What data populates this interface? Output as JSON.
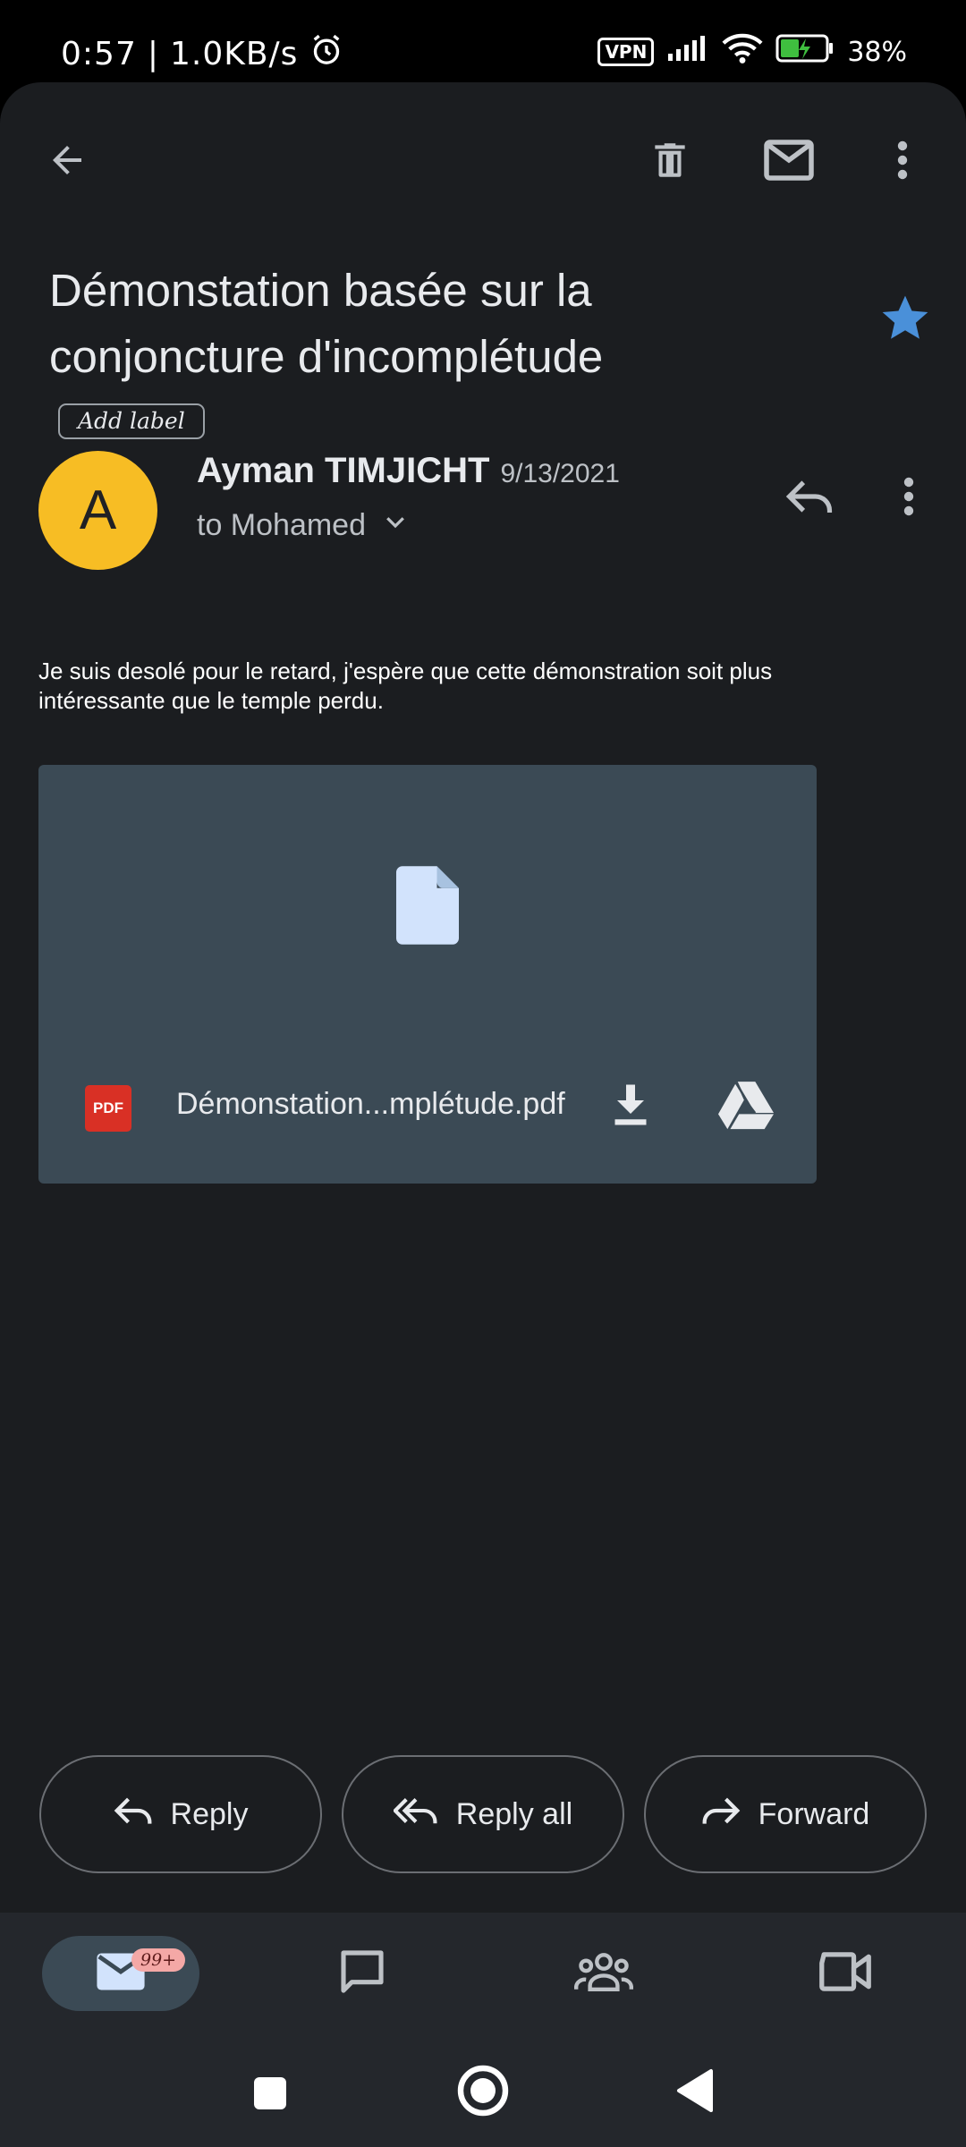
{
  "status_bar": {
    "time": "0:57",
    "separator": "|",
    "net_speed": "1.0KB/s",
    "vpn": "VPN",
    "battery": "38%"
  },
  "toolbar": {
    "back": "arrow-left-icon",
    "delete": "trash-icon",
    "mark_unread": "mail-icon",
    "more": "more-vert-icon"
  },
  "email": {
    "subject": "Démonstation basée sur la conjoncture d'incomplétude",
    "add_label": "Add label",
    "starred": true,
    "star_color": "#4a90d9",
    "sender": {
      "initial": "A",
      "name": "Ayman TIMJICHT",
      "date": "9/13/2021",
      "recipient": "to Mohamed",
      "avatar_color": "#f7bd24"
    },
    "body": "Je suis desolé pour le retard, j'espère que cette démonstration soit plus intéressante que le temple perdu.",
    "attachment": {
      "type_badge": "PDF",
      "file_name": "Démonstation...mplétude.pdf",
      "icons": [
        "document-icon",
        "download-icon",
        "drive-icon"
      ]
    }
  },
  "actions": {
    "reply": "Reply",
    "reply_all": "Reply all",
    "forward": "Forward"
  },
  "bottom_nav": {
    "mail_badge": "99+",
    "items": [
      "mail-icon",
      "chat-icon",
      "spaces-icon",
      "meet-icon"
    ]
  }
}
